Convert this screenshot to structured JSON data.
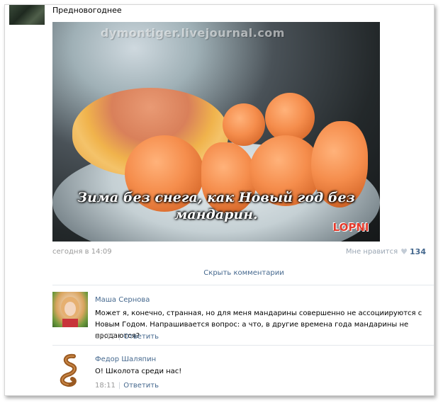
{
  "post": {
    "text": "Предновогоднее",
    "image": {
      "watermark": "dymontiger.livejournal.com",
      "caption": "Зима без снега, как Новый год без мандарин.",
      "logo": "LOPNI"
    },
    "time": "сегодня в 14:09",
    "like_label": "Мне нравится",
    "like_icon": "heart-icon",
    "like_count": "134"
  },
  "hide_comments_label": "Скрыть комментарии",
  "comments": [
    {
      "author": "Маша Сернова",
      "text": "Может я, конечно, странная, но для меня мандарины совершенно не ассоциируются с Новым Годом. Напрашивается вопрос: а что, в другие времена года мандарины не продаются?",
      "time": "18:09",
      "reply_label": "Ответить"
    },
    {
      "author": "Федор Шаляпин",
      "text": "О! Школота среди нас!",
      "time": "18:11",
      "reply_label": "Ответить"
    }
  ],
  "colors": {
    "link": "#45688e",
    "meta": "#999999"
  }
}
